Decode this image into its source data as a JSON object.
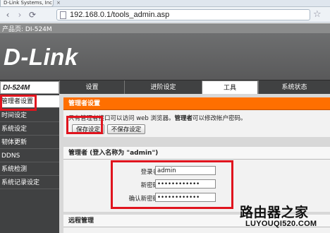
{
  "browser": {
    "tab_title": "D-Link Systems, Inc",
    "tab_close": "×",
    "url": "192.168.0.1/tools_admin.asp",
    "back_icon": "‹",
    "forward_icon": "›",
    "reload_icon": "⟳",
    "star_icon": "☆"
  },
  "router": {
    "product_page": "产品页: DI-524M",
    "logo": "D-Link",
    "model": "DI-524M"
  },
  "tabs": [
    {
      "label": "设置"
    },
    {
      "label": "进阶设定"
    },
    {
      "label": "工具"
    },
    {
      "label": "系统状态"
    }
  ],
  "sidebar": {
    "items": [
      {
        "label": "管理者设置"
      },
      {
        "label": "时间设定"
      },
      {
        "label": "系统设定"
      },
      {
        "label": "韧体更新"
      },
      {
        "label": "DDNS"
      },
      {
        "label": "系统检测"
      },
      {
        "label": "系统记录设定"
      }
    ]
  },
  "admin_panel": {
    "title": "管理者设置",
    "desc_prefix": "只有管理者接口可以访问 web 浏览器。",
    "desc_bold": "管理者",
    "desc_suffix": "可以修改帐户密码。",
    "save_label": "保存设定",
    "nosave_label": "不保存设定"
  },
  "admin_form": {
    "title": "管理者 (登入名称为 \"admin\")",
    "login_label": "登录名:",
    "login_value": "admin",
    "new_password_label": "新密码:",
    "new_password_value": "••••••••••••",
    "confirm_password_label": "确认新密码:",
    "confirm_password_value": "••••••••••••"
  },
  "remote": {
    "title": "远程管理"
  },
  "watermark": {
    "text_cn": "路由器之家",
    "text_url": "LUYOUQI520.COM"
  }
}
